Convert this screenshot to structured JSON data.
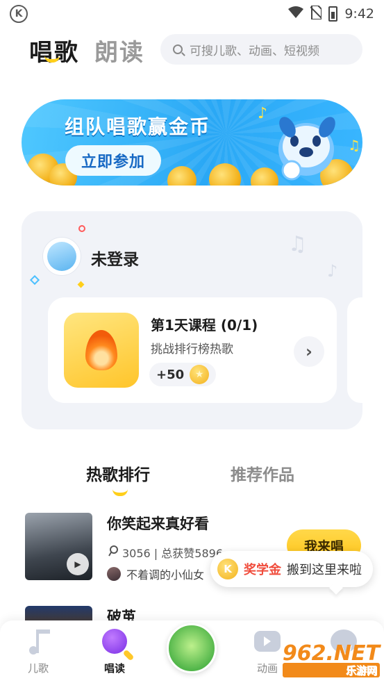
{
  "status_bar": {
    "time": "9:42",
    "app_icon": "K"
  },
  "header": {
    "tabs": [
      {
        "label": "唱歌",
        "active": true
      },
      {
        "label": "朗读",
        "active": false
      }
    ],
    "search_placeholder": "可搜儿歌、动画、短视频"
  },
  "banner": {
    "title": "组队唱歌赢金币",
    "button_label": "立即参加"
  },
  "user_card": {
    "login_label": "未登录",
    "course": {
      "title": "第1天课程 (0/1)",
      "subtitle": "挑战排行榜热歌",
      "reward": "+50"
    }
  },
  "section_tabs": [
    {
      "label": "热歌排行",
      "active": true
    },
    {
      "label": "推荐作品",
      "active": false
    }
  ],
  "songs": [
    {
      "title": "你笑起来真好看",
      "stats": "3056 | 总获赞5896",
      "user": "不着调的小仙女",
      "button_label": "我来唱"
    },
    {
      "title": "破茧"
    }
  ],
  "tooltip": {
    "badge": "K",
    "accent_text": "奖学金",
    "text": "搬到这里来啦"
  },
  "bottom_nav": [
    {
      "label": "儿歌",
      "icon": "music-note-icon",
      "active": false
    },
    {
      "label": "唱读",
      "icon": "microphone-icon",
      "active": true
    },
    {
      "label": "",
      "icon": "center-badge-icon",
      "active": false
    },
    {
      "label": "动画",
      "icon": "tv-play-icon",
      "active": false
    },
    {
      "label": "",
      "icon": "chat-bubble-icon",
      "active": false
    }
  ],
  "watermark": {
    "main": "962.NET",
    "sub": "乐游网"
  },
  "colors": {
    "accent_yellow": "#ffcf1a",
    "banner_blue": "#2aa8f5",
    "tooltip_red": "#f04c3c"
  }
}
